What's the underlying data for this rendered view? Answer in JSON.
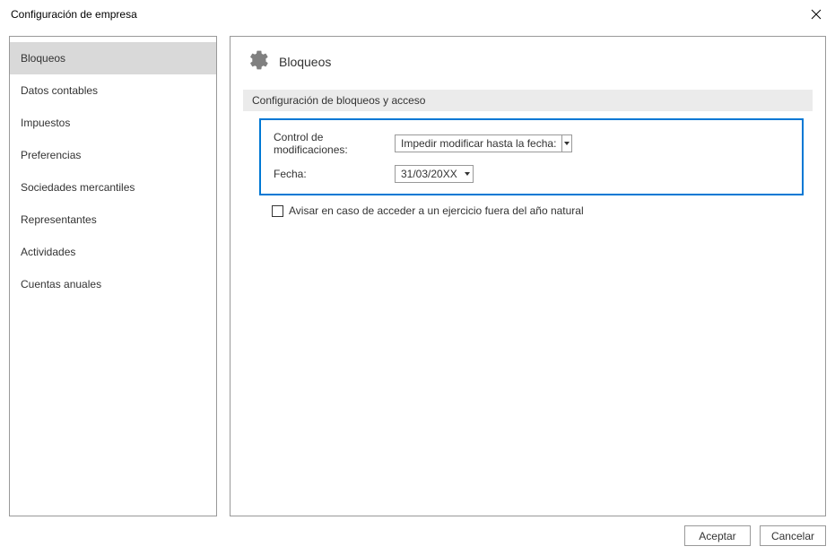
{
  "titlebar": {
    "title": "Configuración de empresa"
  },
  "sidebar": {
    "items": [
      {
        "label": "Bloqueos",
        "selected": true
      },
      {
        "label": "Datos contables",
        "selected": false
      },
      {
        "label": "Impuestos",
        "selected": false
      },
      {
        "label": "Preferencias",
        "selected": false
      },
      {
        "label": "Sociedades mercantiles",
        "selected": false
      },
      {
        "label": "Representantes",
        "selected": false
      },
      {
        "label": "Actividades",
        "selected": false
      },
      {
        "label": "Cuentas anuales",
        "selected": false
      }
    ]
  },
  "main": {
    "title": "Bloqueos",
    "section_header": "Configuración de bloqueos y acceso",
    "control_label": "Control de modificaciones:",
    "control_value": "Impedir modificar hasta la fecha:",
    "date_label": "Fecha:",
    "date_value": "31/03/20XX",
    "checkbox_label": "Avisar en caso de acceder a un ejercicio fuera del año natural"
  },
  "footer": {
    "accept": "Aceptar",
    "cancel": "Cancelar"
  }
}
